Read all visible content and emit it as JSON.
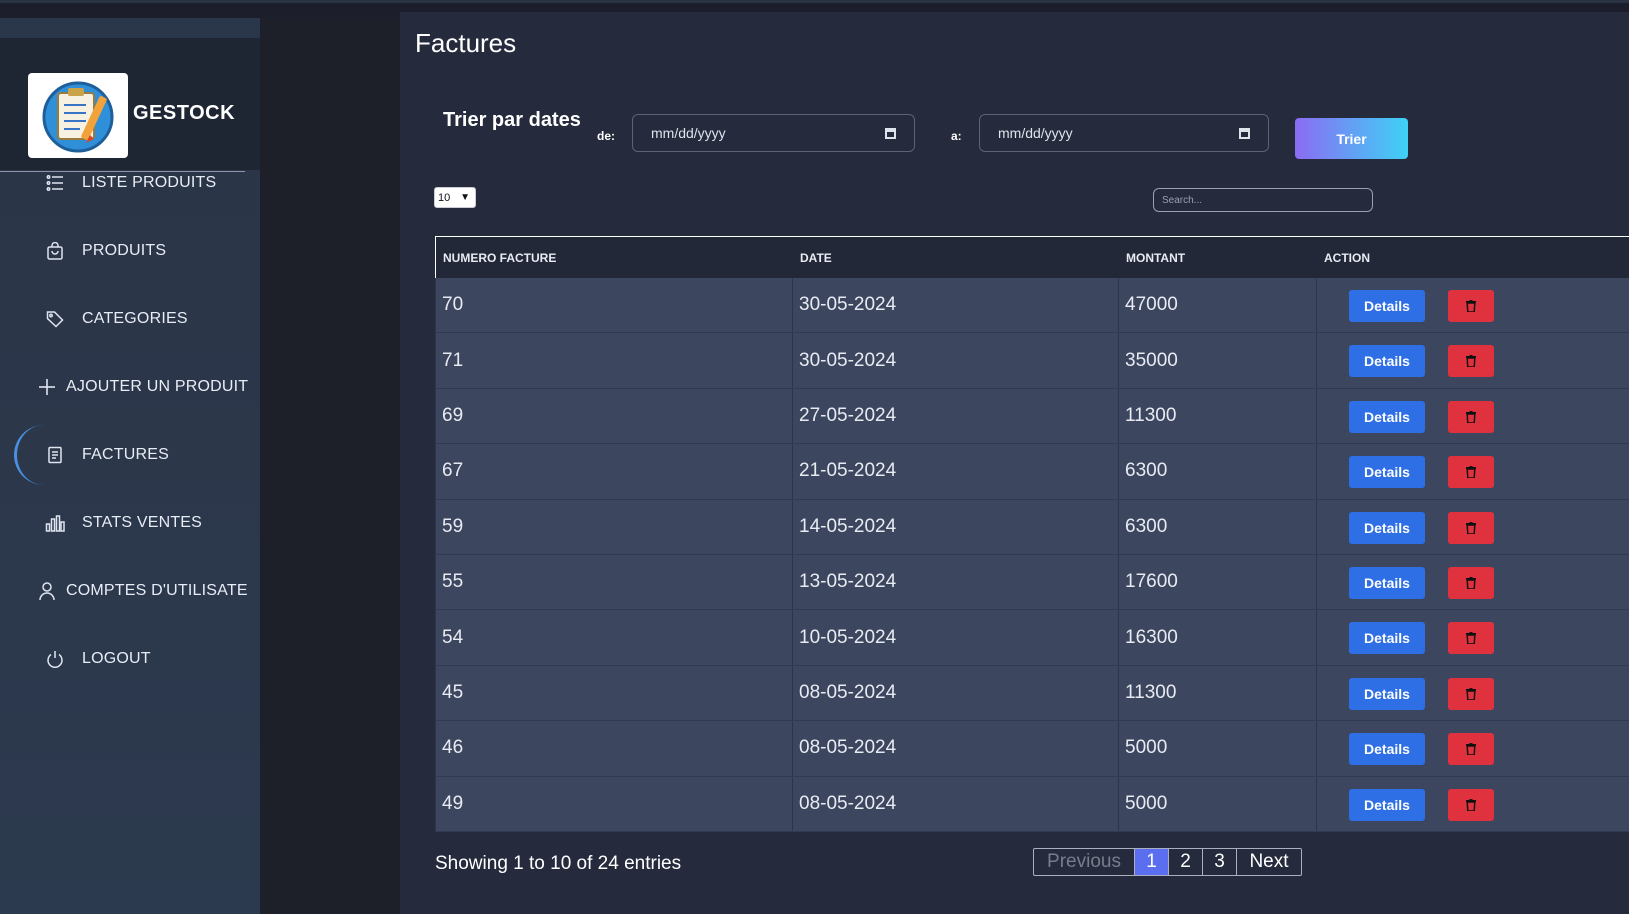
{
  "app": {
    "name": "GESTOCK"
  },
  "sidebar": {
    "items": [
      {
        "label": "LISTE PRODUITS",
        "icon": "list-icon"
      },
      {
        "label": "PRODUITS",
        "icon": "bag-icon"
      },
      {
        "label": "CATEGORIES",
        "icon": "tag-icon"
      },
      {
        "label": "AJOUTER UN PRODUIT",
        "icon": "plus-icon"
      },
      {
        "label": "FACTURES",
        "icon": "receipt-icon",
        "active": true
      },
      {
        "label": "STATS VENTES",
        "icon": "bar-chart-icon"
      },
      {
        "label": "COMPTES D'UTILISATE",
        "icon": "user-icon"
      },
      {
        "label": "LOGOUT",
        "icon": "power-icon"
      }
    ]
  },
  "page": {
    "title": "Factures"
  },
  "filter": {
    "title": "Trier par dates",
    "from_label": "de:",
    "to_label": "a:",
    "from_placeholder": "mm/dd/yyyy",
    "to_placeholder": "mm/dd/yyyy",
    "submit_label": "Trier"
  },
  "table_controls": {
    "page_size": "10",
    "search_placeholder": "Search..."
  },
  "table": {
    "headers": [
      "NUMERO FACTURE",
      "DATE",
      "MONTANT",
      "ACTION"
    ],
    "details_label": "Details",
    "rows": [
      {
        "numero": "70",
        "date": "30-05-2024",
        "montant": "47000"
      },
      {
        "numero": "71",
        "date": "30-05-2024",
        "montant": "35000"
      },
      {
        "numero": "69",
        "date": "27-05-2024",
        "montant": "11300"
      },
      {
        "numero": "67",
        "date": "21-05-2024",
        "montant": "6300"
      },
      {
        "numero": "59",
        "date": "14-05-2024",
        "montant": "6300"
      },
      {
        "numero": "55",
        "date": "13-05-2024",
        "montant": "17600"
      },
      {
        "numero": "54",
        "date": "10-05-2024",
        "montant": "16300"
      },
      {
        "numero": "45",
        "date": "08-05-2024",
        "montant": "11300"
      },
      {
        "numero": "46",
        "date": "08-05-2024",
        "montant": "5000"
      },
      {
        "numero": "49",
        "date": "08-05-2024",
        "montant": "5000"
      }
    ]
  },
  "footer": {
    "showing": "Showing 1 to 10 of 24 entries",
    "prev_label": "Previous",
    "pages": [
      "1",
      "2",
      "3"
    ],
    "current_page": "1",
    "next_label": "Next"
  },
  "colors": {
    "accent_blue": "#2f6fe6",
    "danger_red": "#e0323e",
    "gradient_start": "#8a6cf3",
    "gradient_end": "#3ed1f5",
    "page_active": "#5b6ef0"
  }
}
